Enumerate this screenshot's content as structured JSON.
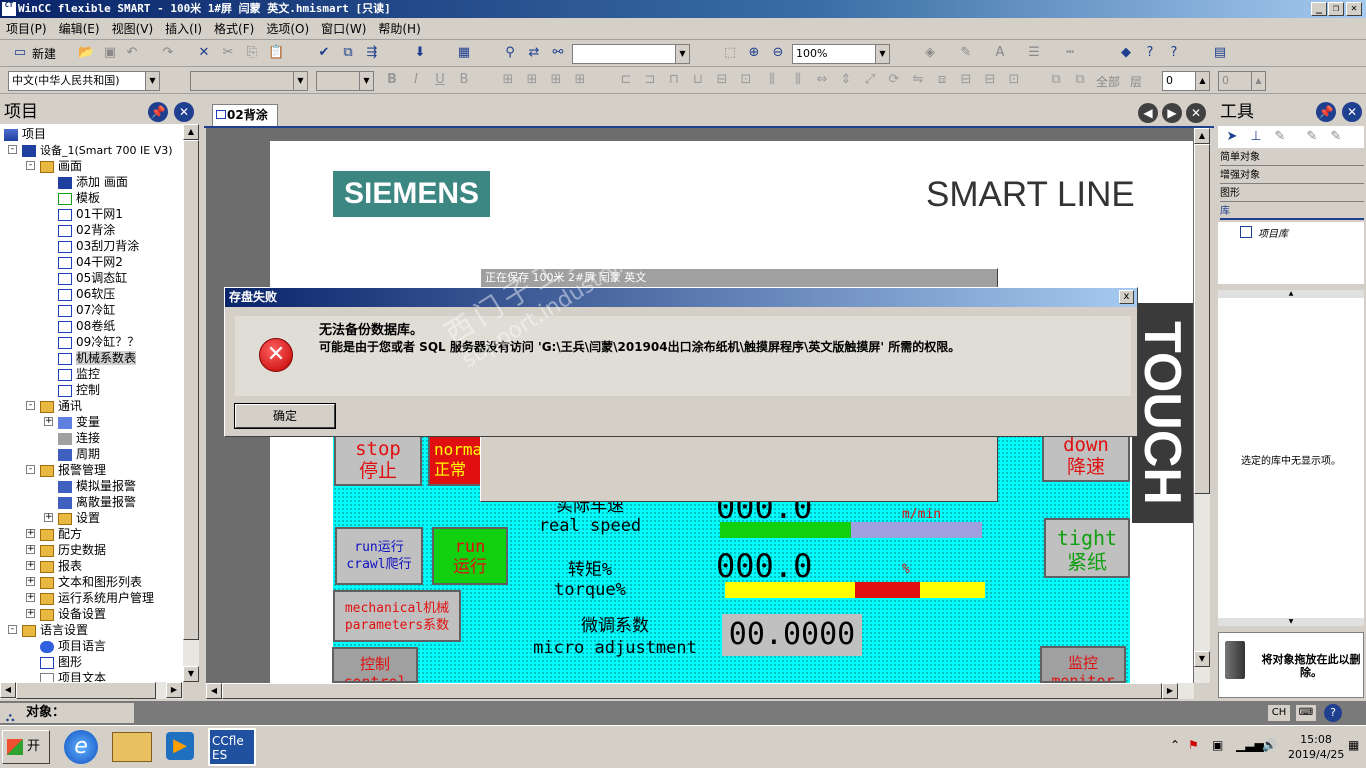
{
  "window": {
    "title": "WinCC flexible SMART - 100米 1#屏 闫蒙 英文.hmismart [只读]",
    "icon_text": "CT"
  },
  "menu": [
    "项目(P)",
    "编辑(E)",
    "视图(V)",
    "插入(I)",
    "格式(F)",
    "选项(O)",
    "窗口(W)",
    "帮助(H)"
  ],
  "toolbar": {
    "new_label": "新建",
    "zoom": "100%",
    "language": "中文(中华人民共和国)",
    "all_label": "全部",
    "layer_label": "层",
    "layer_value": "0",
    "second_value": "0"
  },
  "project_panel": {
    "title": "项目",
    "tree": [
      {
        "label": "项目",
        "level": 0,
        "icon": "project"
      },
      {
        "label": "设备_1(Smart 700 IE V3)",
        "level": 1,
        "icon": "device",
        "exp": "-"
      },
      {
        "label": "画面",
        "level": 2,
        "icon": "folder",
        "exp": "-"
      },
      {
        "label": "添加 画面",
        "level": 3,
        "icon": "add"
      },
      {
        "label": "模板",
        "level": 3,
        "icon": "template"
      },
      {
        "label": "01干网1",
        "level": 3,
        "icon": "page"
      },
      {
        "label": "02背涂",
        "level": 3,
        "icon": "page"
      },
      {
        "label": "03刮刀背涂",
        "level": 3,
        "icon": "page"
      },
      {
        "label": "04干网2",
        "level": 3,
        "icon": "page"
      },
      {
        "label": "05调态缸",
        "level": 3,
        "icon": "page"
      },
      {
        "label": "06软压",
        "level": 3,
        "icon": "page"
      },
      {
        "label": "07冷缸",
        "level": 3,
        "icon": "page"
      },
      {
        "label": "08卷纸",
        "level": 3,
        "icon": "page"
      },
      {
        "label": "09冷缸？？",
        "level": 3,
        "icon": "page"
      },
      {
        "label": "机械系数表",
        "level": 3,
        "icon": "page",
        "selected": true
      },
      {
        "label": "监控",
        "level": 3,
        "icon": "page"
      },
      {
        "label": "控制",
        "level": 3,
        "icon": "page"
      },
      {
        "label": "通讯",
        "level": 2,
        "icon": "folder",
        "exp": "-"
      },
      {
        "label": "变量",
        "level": 3,
        "icon": "tag",
        "exp": "+"
      },
      {
        "label": "连接",
        "level": 3,
        "icon": "connection"
      },
      {
        "label": "周期",
        "level": 3,
        "icon": "cycle"
      },
      {
        "label": "报警管理",
        "level": 2,
        "icon": "folder",
        "exp": "-"
      },
      {
        "label": "模拟量报警",
        "level": 3,
        "icon": "alarm"
      },
      {
        "label": "离散量报警",
        "level": 3,
        "icon": "alarm"
      },
      {
        "label": "设置",
        "level": 3,
        "icon": "folder",
        "exp": "+"
      },
      {
        "label": "配方",
        "level": 2,
        "icon": "folder",
        "exp": "+"
      },
      {
        "label": "历史数据",
        "level": 2,
        "icon": "folder",
        "exp": "+"
      },
      {
        "label": "报表",
        "level": 2,
        "icon": "folder",
        "exp": "+"
      },
      {
        "label": "文本和图形列表",
        "level": 2,
        "icon": "folder",
        "exp": "+"
      },
      {
        "label": "运行系统用户管理",
        "level": 2,
        "icon": "folder",
        "exp": "+"
      },
      {
        "label": "设备设置",
        "level": 2,
        "icon": "folder",
        "exp": "+"
      },
      {
        "label": "语言设置",
        "level": 1,
        "icon": "folder",
        "exp": "-"
      },
      {
        "label": "项目语言",
        "level": 2,
        "icon": "globe"
      },
      {
        "label": "图形",
        "level": 2,
        "icon": "graphic"
      },
      {
        "label": "项目文本",
        "level": 2,
        "icon": "text"
      }
    ]
  },
  "editor": {
    "tab_label": "02背涂"
  },
  "hmi": {
    "brand": "SIEMENS",
    "product": "SMART LINE",
    "touch": "TOUCH",
    "buttons": {
      "stop": [
        "stop",
        "停止"
      ],
      "normal": [
        "norma",
        "正常"
      ],
      "down": [
        "down",
        "降速"
      ],
      "tight": [
        "tight",
        "紧纸"
      ],
      "crawl": [
        "run运行",
        "crawl爬行"
      ],
      "run": [
        "run",
        "运行"
      ],
      "mech": [
        "mechanical机械",
        "parameters系数"
      ],
      "control": [
        "控制",
        "control"
      ],
      "monitor": [
        "监控",
        "monitor"
      ]
    },
    "speed_label": [
      "实际车速",
      "real speed"
    ],
    "speed_value": "000.0",
    "speed_unit": "m/min",
    "speed_fraction": 0.5,
    "torque_label": [
      "转矩%",
      "torque%"
    ],
    "torque_value": "000.0",
    "torque_unit": "%",
    "micro_label": [
      "微调系数",
      "micro adjustment"
    ],
    "micro_value": "00.0000",
    "saving_window_title": "正在保存 100米 2#屏 闫蒙 英文"
  },
  "dialog": {
    "title": "存盘失败",
    "message_line1": "无法备份数据库。",
    "message_line2": "可能是由于您或者 SQL 服务器没有访问 'G:\\王兵\\闫蒙\\201904出口涂布纸机\\触摸屏程序\\英文版触摸屏' 所需的权限。",
    "ok_label": "确定",
    "close_label": "x"
  },
  "watermark": {
    "line1": "西门子工业  找答案",
    "line2": "support.industry.siemens.com/cs"
  },
  "tools_panel": {
    "title": "工具",
    "sections": [
      "简单对象",
      "增强对象",
      "图形",
      "库"
    ],
    "library_item": "项目库",
    "empty_message": "选定的库中无显示项。",
    "delete_hint": "将对象拖放在此以删除。"
  },
  "objects_bar": {
    "label": "对象："
  },
  "status": {
    "lang": "CH"
  },
  "taskbar": {
    "start_label": "开始",
    "time": "15:08",
    "date": "2019/4/25",
    "app_label": "CCfle ES"
  },
  "colors": {
    "hmi_bg": "#00ffff",
    "siemens": "#3c8782",
    "dialog_title_start": "#0a246a"
  }
}
